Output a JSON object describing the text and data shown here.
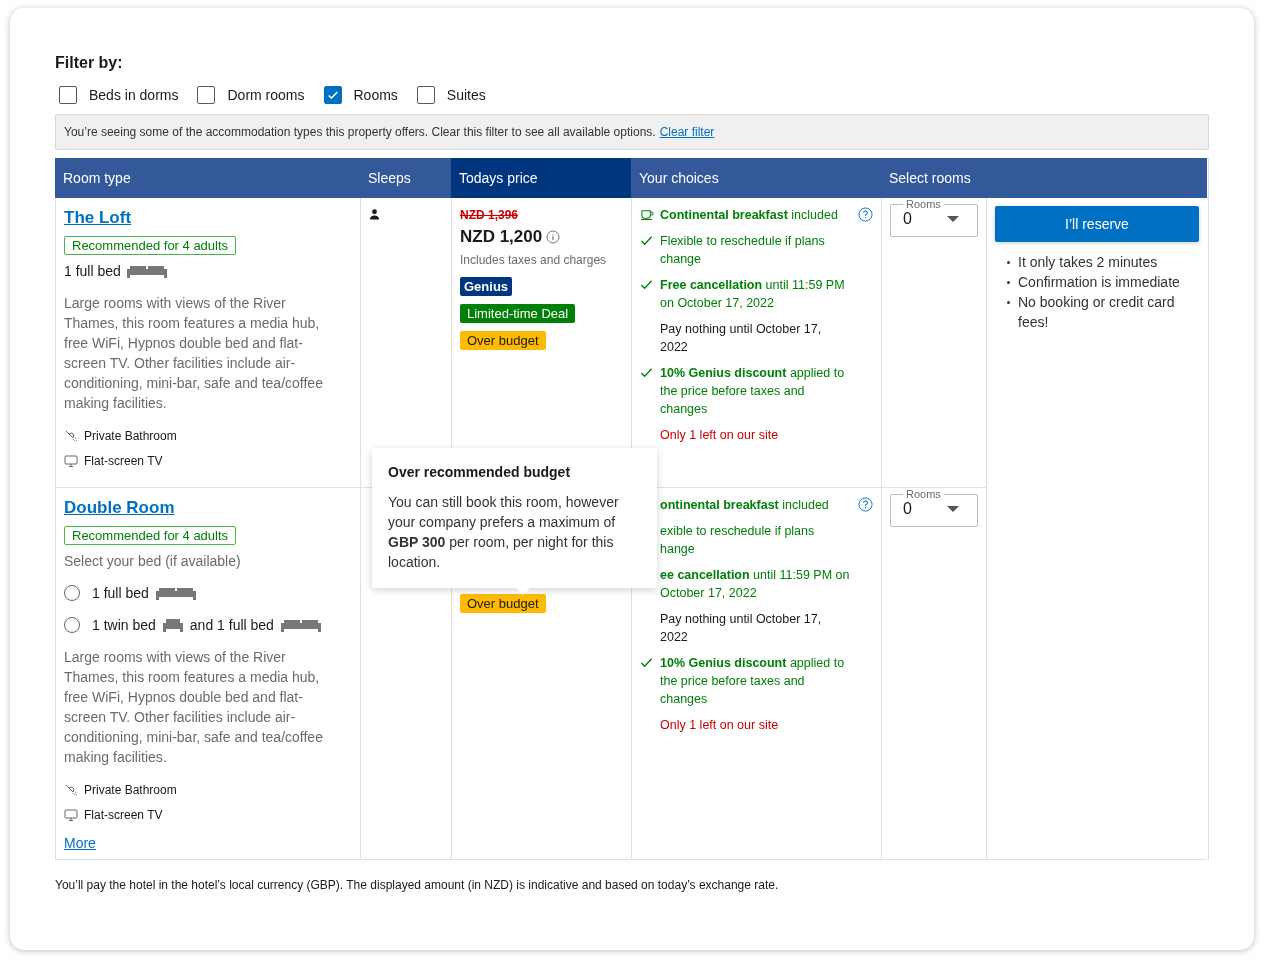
{
  "filter": {
    "title": "Filter by:",
    "options": [
      {
        "label": "Beds in dorms",
        "checked": false
      },
      {
        "label": "Dorm rooms",
        "checked": false
      },
      {
        "label": "Rooms",
        "checked": true
      },
      {
        "label": "Suites",
        "checked": false
      }
    ]
  },
  "notice": {
    "text": "You’re seeing some of the accommodation types this property offers. Clear this filter to see all available options.",
    "link": "Clear filter"
  },
  "table": {
    "columns": [
      {
        "label": "Room type",
        "highlight": false
      },
      {
        "label": "Sleeps",
        "highlight": false
      },
      {
        "label": "Todays price",
        "highlight": true
      },
      {
        "label": "Your choices",
        "highlight": false
      },
      {
        "label": "Select rooms",
        "highlight": false
      }
    ],
    "rows": [
      {
        "name": "The Loft",
        "badge": "Recommended for 4 adults",
        "bed": {
          "parts": [
            {
              "text": "1 full bed",
              "kind": "full"
            }
          ]
        },
        "description": "Large rooms with views of the River Thames, this room features a media hub, free WiFi, Hypnos double bed and flat-screen TV. Other facilities include air-conditioning, mini-bar, safe and tea/coffee making facilities.",
        "facilities": [
          {
            "kind": "bathroom",
            "text": "Private Bathroom"
          },
          {
            "kind": "tv",
            "text": "Flat-screen TV"
          }
        ],
        "occupancy_icon": true,
        "price": {
          "old": "NZD 1,396",
          "current": "NZD 1,200",
          "note": "Includes taxes and charges"
        },
        "badges": [
          {
            "kind": "genius",
            "text": "Genius"
          },
          {
            "kind": "deal",
            "text": "Limited-time Deal"
          },
          {
            "kind": "over",
            "text": "Over budget"
          }
        ],
        "choices": [
          {
            "kind": "breakfast",
            "icon_shown": true,
            "text": "**Continental breakfast** included",
            "help": true
          },
          {
            "kind": "perk",
            "icon_shown": true,
            "text": "Flexible to reschedule if plans change"
          },
          {
            "kind": "perk",
            "icon_shown": true,
            "text": "**Free cancellation** until 11:59 PM on October 17, 2022"
          },
          {
            "kind": "note",
            "text": "Pay nothing until October 17, 2022"
          },
          {
            "kind": "perk",
            "icon_shown": true,
            "text": "**10% Genius discount** applied to the price before taxes and changes"
          },
          {
            "kind": "scarcity",
            "text": "Only 1 left on our site"
          }
        ],
        "rooms": {
          "label": "Rooms",
          "value": "0"
        }
      },
      {
        "name": "Double Room",
        "badge": "Recommended for 4 adults",
        "bed_prompt": "Select your bed (if available)",
        "bed_options": [
          {
            "selected": false,
            "parts": [
              {
                "text": "1 full bed",
                "kind": "full"
              }
            ]
          },
          {
            "selected": false,
            "parts": [
              {
                "text": "1 twin bed",
                "kind": "twin"
              },
              {
                "text": "and 1 full bed",
                "kind": "full"
              }
            ]
          }
        ],
        "description": "Large rooms with views of the River Thames, this room features a media hub, free WiFi, Hypnos double bed and flat-screen TV. Other facilities include air-conditioning, mini-bar, safe and tea/coffee making facilities.",
        "facilities": [
          {
            "kind": "bathroom",
            "text": "Private Bathroom"
          },
          {
            "kind": "tv",
            "text": "Flat-screen TV"
          }
        ],
        "more": "More",
        "badges": [
          {
            "kind": "over",
            "text": "Over budget"
          }
        ],
        "tooltip": {
          "title": "Over recommended budget",
          "text": "You can still book this room, however your company prefers a maximum of **GBP 300** per room, per night for this location."
        },
        "choices": [
          {
            "kind": "breakfast",
            "text": "**ontinental breakfast** included",
            "help": true
          },
          {
            "kind": "perk",
            "text": "exible to reschedule if plans hange"
          },
          {
            "kind": "perk",
            "text": "**ee cancellation** until 11:59 PM on October 17, 2022"
          },
          {
            "kind": "note",
            "text": "Pay nothing until October 17, 2022"
          },
          {
            "kind": "perk",
            "icon_shown": true,
            "text": "**10% Genius discount** applied to the price before taxes and changes"
          },
          {
            "kind": "scarcity",
            "text": "Only 1 left on our site"
          }
        ],
        "rooms": {
          "label": "Rooms",
          "value": "0"
        }
      }
    ]
  },
  "reserve": {
    "button": "I’ll reserve",
    "bullets": [
      "It only takes 2 minutes",
      "Confirmation is immediate",
      "No booking or credit card fees!"
    ]
  },
  "footnote": "You’ll pay the hotel in the hotel’s local currency (GBP). The displayed amount (in NZD) is indicative and based on today’s exchange rate."
}
